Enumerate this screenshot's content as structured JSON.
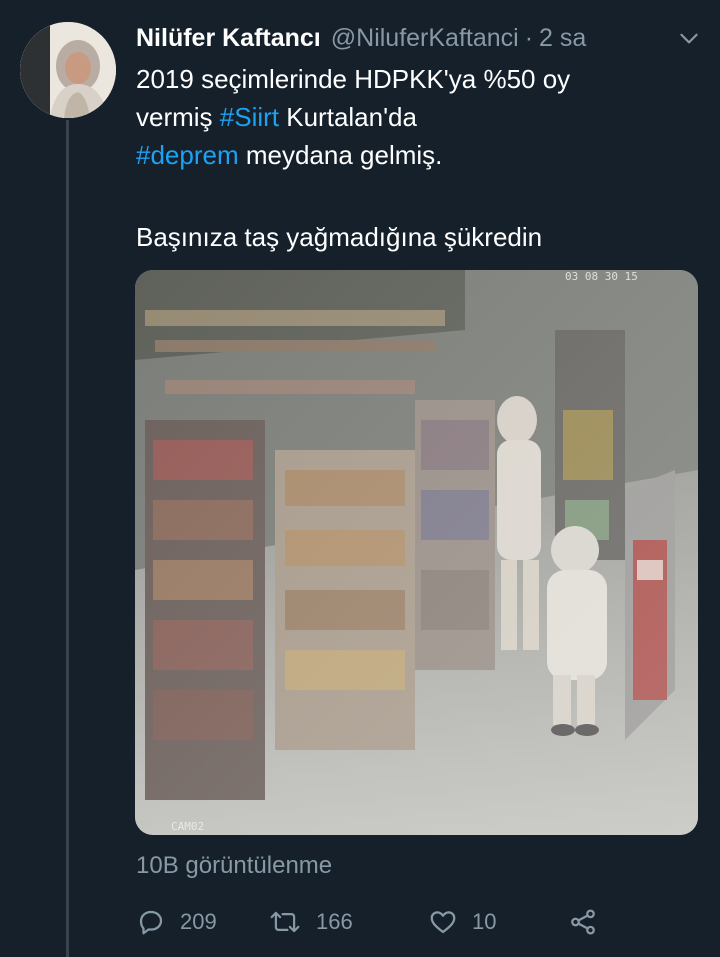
{
  "tweet": {
    "author_name": "Nilüfer Kaftancı",
    "handle": "@NiluferKaftanci",
    "separator": "·",
    "time": "2 sa",
    "text_lines": [
      [
        {
          "t": "2019 seçimlerinde HDPKK'ya %50 oy"
        }
      ],
      [
        {
          "t": "vermiş "
        },
        {
          "t": "#Siirt",
          "tag": true
        },
        {
          "t": " Kurtalan'da"
        }
      ],
      [
        {
          "t": "#deprem",
          "tag": true
        },
        {
          "t": " meydana gelmiş."
        }
      ],
      [],
      [
        {
          "t": "Başınıza taş yağmadığına şükredin"
        }
      ]
    ],
    "media": {
      "camera_label": "CAM02",
      "timestamp_overlay": "03 08 30 15"
    },
    "views": "10B görüntülenme",
    "actions": {
      "reply_count": "209",
      "retweet_count": "166",
      "like_count": "10"
    }
  },
  "icons": {
    "menu": "chevron-down-icon",
    "reply": "reply-icon",
    "retweet": "retweet-icon",
    "like": "heart-icon",
    "share": "share-icon"
  },
  "colors": {
    "background": "#15202b",
    "hashtag": "#1da1f2",
    "secondary_text": "#8899a6",
    "thread_line": "#38444d"
  }
}
